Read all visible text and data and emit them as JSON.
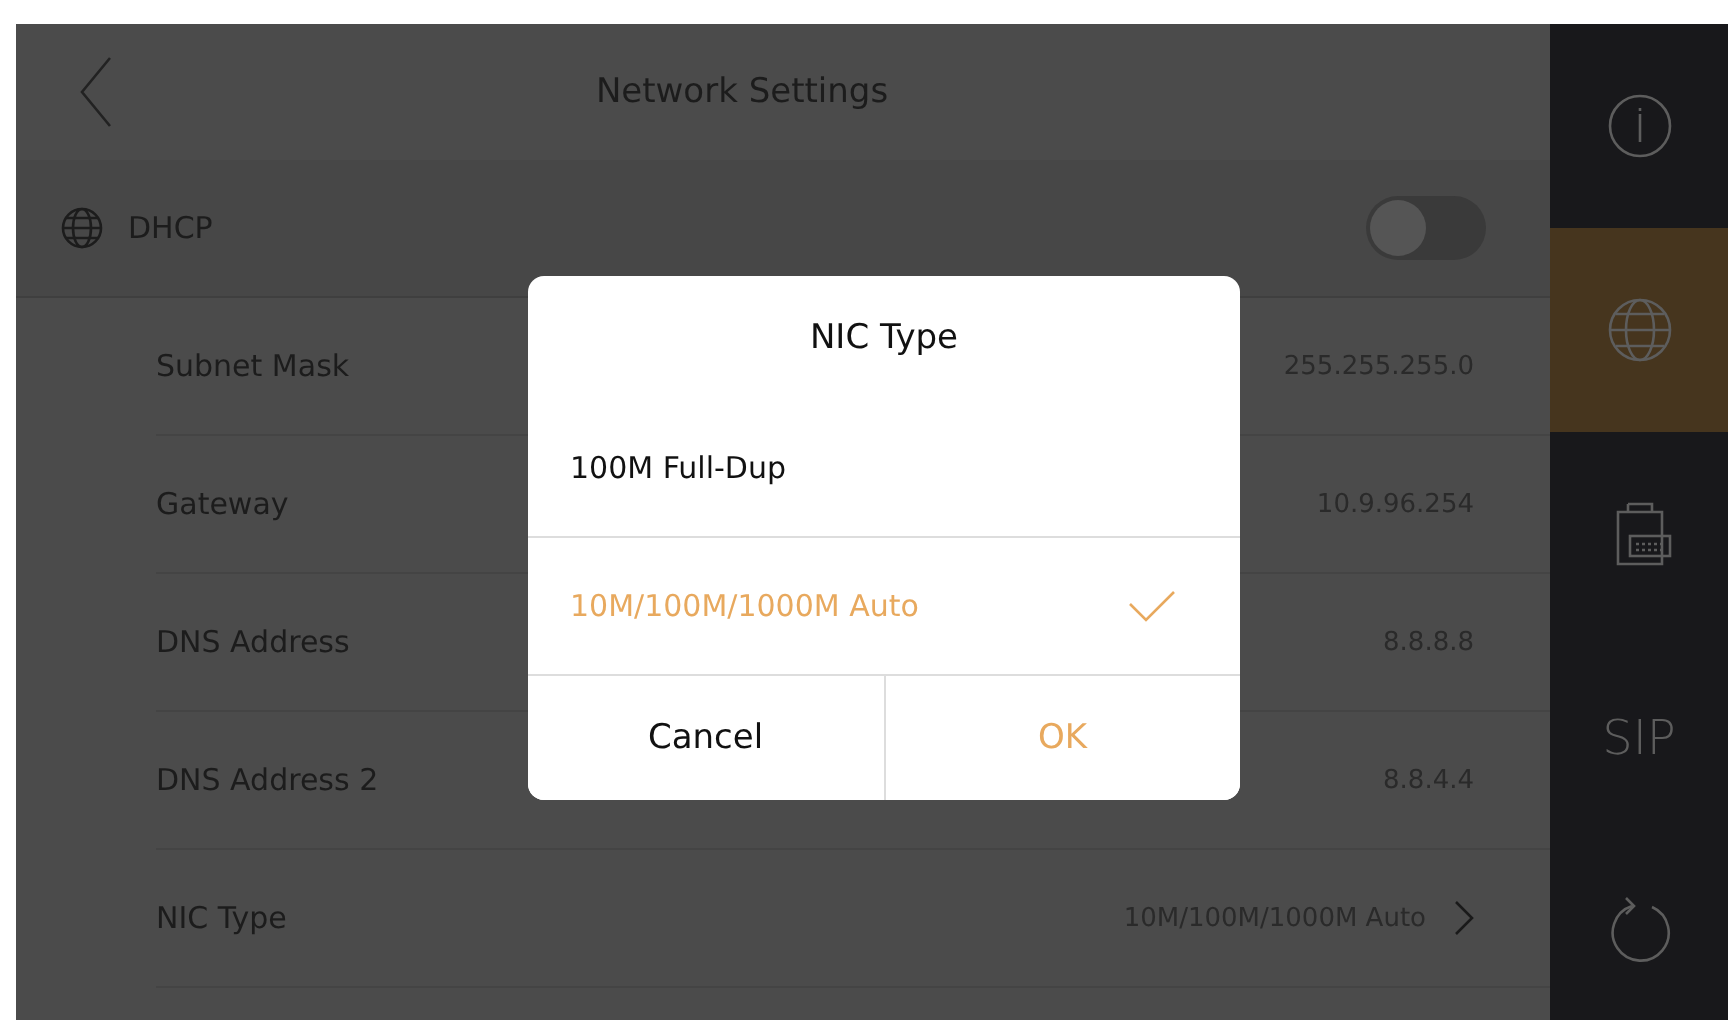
{
  "header": {
    "title": "Network Settings"
  },
  "dhcp": {
    "label": "DHCP",
    "on": false
  },
  "rows": [
    {
      "label": "Subnet Mask",
      "value": "255.255.255.0",
      "arrow": false
    },
    {
      "label": "Gateway",
      "value": "10.9.96.254",
      "arrow": false
    },
    {
      "label": "DNS Address",
      "value": "8.8.8.8",
      "arrow": false
    },
    {
      "label": "DNS Address 2",
      "value": "8.8.4.4",
      "arrow": false
    },
    {
      "label": "NIC Type",
      "value": "10M/100M/1000M Auto",
      "arrow": true
    }
  ],
  "sidebar": {
    "items": [
      {
        "kind": "info",
        "selected": false
      },
      {
        "kind": "globe",
        "selected": true
      },
      {
        "kind": "device",
        "selected": false
      },
      {
        "kind": "text",
        "label": "SIP",
        "selected": false
      },
      {
        "kind": "refresh",
        "selected": false
      }
    ]
  },
  "dialog": {
    "title": "NIC Type",
    "options": [
      {
        "label": "100M Full-Dup",
        "selected": false
      },
      {
        "label": "10M/100M/1000M Auto",
        "selected": true
      }
    ],
    "cancel": "Cancel",
    "ok": "OK"
  }
}
